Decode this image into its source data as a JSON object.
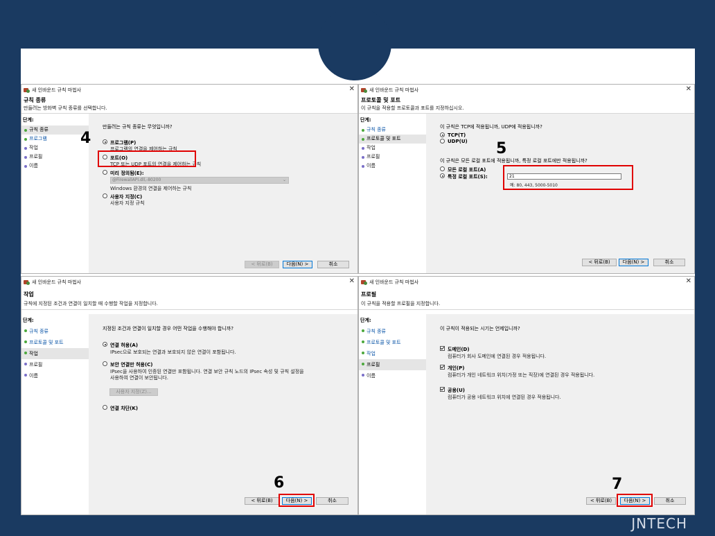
{
  "brand": "JNTECH",
  "step_numbers": [
    "4",
    "5",
    "6",
    "7"
  ],
  "wizard_title": "새 인바운드 규칙 마법사",
  "steps_label": "단계:",
  "buttons": {
    "back": "< 뒤로(B)",
    "next": "다음(N) >",
    "cancel": "취소"
  },
  "windows": [
    {
      "header_title": "규칙 종류",
      "header_sub": "만들려는 방화벽 규칙 종류를 선택합니다.",
      "steps": [
        "규칙 종류",
        "프로그램",
        "작업",
        "프로필",
        "이름"
      ],
      "question": "만들려는 규칙 종류는 무엇입니까?",
      "options": [
        {
          "label": "프로그램(P)",
          "desc": "프로그램의 연결을 제어하는 규칙"
        },
        {
          "label": "포트(O)",
          "desc": "TCP 또는 UDP 포트의 연결을 제어하는 규칙"
        },
        {
          "label": "미리 정의됨(E):",
          "desc": "Windows 환경의 연결을 제어하는 규칙"
        },
        {
          "label": "사용자 지정(C)",
          "desc": "사용자 지정 규칙"
        }
      ],
      "predefined_value": "@FirewallAPI.dll,-80200"
    },
    {
      "header_title": "프로토콜 및 포트",
      "header_sub": "이 규칙을 적용할 프로토콜과 포트를 지정하십시오.",
      "steps": [
        "규칙 종류",
        "프로토콜 및 포트",
        "작업",
        "프로필",
        "이름"
      ],
      "question1": "이 규칙은 TCP에 적용됩니까, UDP에 적용됩니까?",
      "proto_options": [
        "TCP(T)",
        "UDP(U)"
      ],
      "question2": "이 규칙은 모든 로컬 포트에 적용됩니까, 특정 로컬 포트에만 적용됩니까?",
      "port_options": [
        "모든 로컬 포트(A)",
        "특정 로컬 포트(S):"
      ],
      "port_value": "21",
      "port_example": "예: 80, 443, 5000-5010"
    },
    {
      "header_title": "작업",
      "header_sub": "규칙에 지정된 조건과 연결이 일치할 때 수행할 작업을 지정합니다.",
      "steps": [
        "규칙 종류",
        "프로토콜 및 포트",
        "작업",
        "프로필",
        "이름"
      ],
      "question": "지정된 조건과 연결이 일치할 경우 어떤 작업을 수행해야 합니까?",
      "options": [
        {
          "label": "연결 허용(A)",
          "desc": "IPsec으로 보호되는 연결과 보호되지 않은 연결이 포함됩니다."
        },
        {
          "label": "보안 연결만 허용(C)",
          "desc": "IPsec을 사용하여 인증된 연결만 포함됩니다. 연결 보안 규칙 노드의 IPsec 속성 및 규칙 설정을",
          "desc2": "사용하여 연결이 보안됩니다."
        },
        {
          "label": "연결 차단(K)",
          "desc": ""
        }
      ],
      "customize_button": "사용자 지정(Z)..."
    },
    {
      "header_title": "프로필",
      "header_sub": "이 규칙을 적용할 프로필을 지정합니다.",
      "steps": [
        "규칙 종류",
        "프로토콜 및 포트",
        "작업",
        "프로필",
        "이름"
      ],
      "question": "이 규칙이 적용되는 시기는 언제입니까?",
      "options": [
        {
          "label": "도메인(D)",
          "desc": "컴퓨터가 회사 도메인에 연결된 경우 적용됩니다."
        },
        {
          "label": "개인(P)",
          "desc": "컴퓨터가 개인 네트워크 위치(가정 또는 직장)에 연결된 경우 적용됩니다."
        },
        {
          "label": "공용(U)",
          "desc": "컴퓨터가 공용 네트워크 위치에 연결된 경우 적용됩니다."
        }
      ]
    }
  ]
}
